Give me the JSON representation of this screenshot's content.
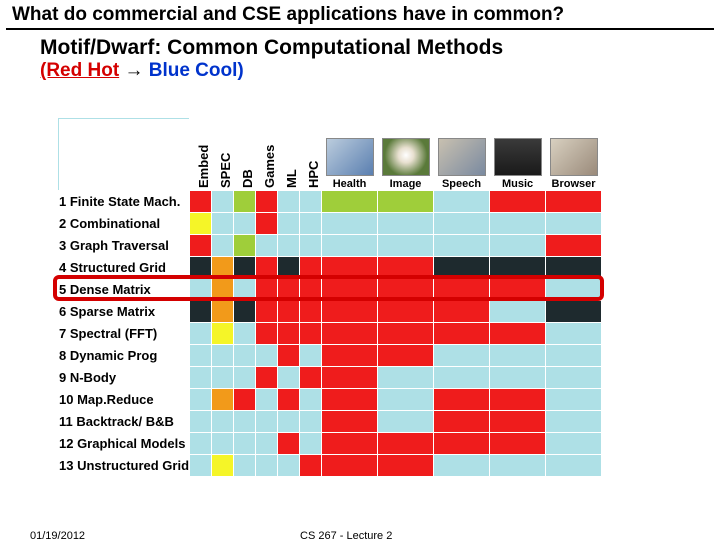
{
  "title": "What  do commercial and CSE applications have in common?",
  "subtitle": "Motif/Dwarf: Common Computational Methods",
  "legend": {
    "left": "(Red Hot",
    "arrow": "→",
    "right": "Blue Cool)"
  },
  "footer": {
    "date": "01/19/2012",
    "mid": "CS 267 - Lecture 2"
  },
  "chart_data": {
    "type": "heatmap",
    "title": "Motif/Dwarf heat map",
    "narrow_cols": [
      "Embed",
      "SPEC",
      "DB",
      "Games",
      "ML",
      "HPC"
    ],
    "wide_cols": [
      "Health",
      "Image",
      "Speech",
      "Music",
      "Browser"
    ],
    "wide_col_thumbs": [
      "linear-gradient(135deg,#bcd 0%,#5a7fb0 100%)",
      "radial-gradient(circle at 50% 45%,#fff 0%,#e8e0d0 25%,#5a7a3a 70%)",
      "linear-gradient(135deg,#c8c0b0 0%,#7a8aa0 100%)",
      "linear-gradient(180deg,#3a3a3a 0%,#1a1a1a 100%)",
      "linear-gradient(135deg,#d8d0c0 0%,#9a8a7a 100%)"
    ],
    "rows": [
      {
        "n": "1",
        "label": "Finite State Mach."
      },
      {
        "n": "2",
        "label": "Combinational"
      },
      {
        "n": "3",
        "label": "Graph Traversal"
      },
      {
        "n": "4",
        "label": "Structured Grid"
      },
      {
        "n": "5",
        "label": "Dense Matrix"
      },
      {
        "n": "6",
        "label": "Sparse Matrix"
      },
      {
        "n": "7",
        "label": "Spectral (FFT)"
      },
      {
        "n": "8",
        "label": "Dynamic Prog"
      },
      {
        "n": "9",
        "label": "N-Body"
      },
      {
        "n": "10",
        "label": "Map.Reduce"
      },
      {
        "n": "11",
        "label": "Backtrack/ B&B"
      },
      {
        "n": "12",
        "label": "Graphical Models"
      },
      {
        "n": "13",
        "label": "Unstructured Grid"
      }
    ],
    "legend_scale": [
      "red=hot",
      "orange",
      "yellow",
      "green",
      "blue=cool"
    ],
    "cells": [
      [
        "red",
        "bg",
        "grn",
        "red",
        "bg",
        "bg",
        "grn",
        "grn",
        "bg",
        "red",
        "red"
      ],
      [
        "yel",
        "bg",
        "bg",
        "red",
        "bg",
        "bg",
        "bg",
        "bg",
        "bg",
        "bg",
        "bg"
      ],
      [
        "red",
        "bg",
        "grn",
        "bg",
        "bg",
        "bg",
        "bg",
        "bg",
        "bg",
        "bg",
        "red"
      ],
      [
        "dk",
        "or",
        "dk",
        "red",
        "dk",
        "red",
        "red",
        "red",
        "dk",
        "dk",
        "dk"
      ],
      [
        "bg",
        "or",
        "bg",
        "red",
        "red",
        "red",
        "red",
        "red",
        "red",
        "red",
        "bg"
      ],
      [
        "dk",
        "or",
        "dk",
        "red",
        "red",
        "red",
        "red",
        "red",
        "red",
        "bg",
        "dk"
      ],
      [
        "bg",
        "yel",
        "bg",
        "red",
        "red",
        "red",
        "red",
        "red",
        "red",
        "red",
        "bg"
      ],
      [
        "bg",
        "bg",
        "bg",
        "bg",
        "red",
        "bg",
        "red",
        "red",
        "bg",
        "bg",
        "bg"
      ],
      [
        "bg",
        "bg",
        "bg",
        "red",
        "bg",
        "red",
        "red",
        "bg",
        "bg",
        "bg",
        "bg"
      ],
      [
        "bg",
        "or",
        "red",
        "bg",
        "red",
        "bg",
        "red",
        "bg",
        "red",
        "red",
        "bg"
      ],
      [
        "bg",
        "bg",
        "bg",
        "bg",
        "bg",
        "bg",
        "red",
        "bg",
        "red",
        "red",
        "bg"
      ],
      [
        "bg",
        "bg",
        "bg",
        "bg",
        "red",
        "bg",
        "red",
        "red",
        "red",
        "red",
        "bg"
      ],
      [
        "bg",
        "yel",
        "bg",
        "bg",
        "bg",
        "red",
        "red",
        "red",
        "bg",
        "bg",
        "bg"
      ]
    ],
    "highlight_row_index": 4
  }
}
